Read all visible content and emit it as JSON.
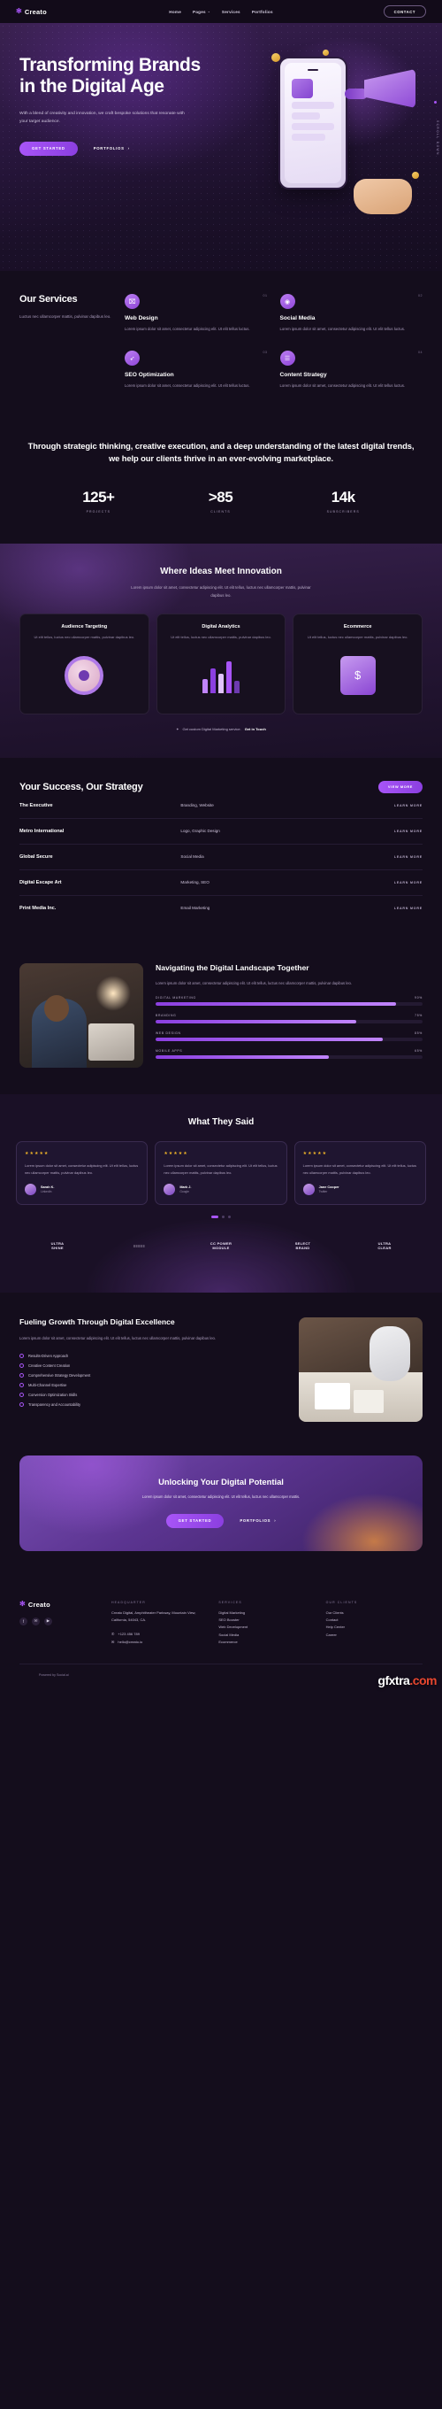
{
  "nav": {
    "brand": "Creato",
    "brand_mark": "leaf-icon",
    "links": [
      {
        "label": "Home",
        "caret": ""
      },
      {
        "label": "Pages",
        "caret": "⌄"
      },
      {
        "label": "Services",
        "caret": ""
      },
      {
        "label": "Portfolios",
        "caret": ""
      }
    ],
    "contact": "CONTACT"
  },
  "hero": {
    "title": "Transforming Brands in the Digital Age",
    "paragraph": "With a blend of creativity and innovation, we craft bespoke solutions that resonate with your target audience.",
    "primary_btn": "GET STARTED",
    "secondary_btn": "PORTFOLIOS",
    "secondary_arrow": "›",
    "side_label": "SCROLL DOWN"
  },
  "services": {
    "title": "Our Services",
    "subtitle": "Luctus nec ullamcorper mattis, pulvinar dapibus leo.",
    "items": [
      {
        "num": "01",
        "icon": "monitor-icon",
        "glyph": "⌧",
        "title": "Web Design",
        "desc": "Lorem ipsum dolor sit amet, consectetur adipiscing elit. Ut elit tellus luctus."
      },
      {
        "num": "02",
        "icon": "megaphone-icon",
        "glyph": "◉",
        "title": "Social Media",
        "desc": "Lorem ipsum dolor sit amet, consectetur adipiscing elit. Ut elit tellus luctus."
      },
      {
        "num": "03",
        "icon": "rocket-icon",
        "glyph": "➶",
        "title": "SEO Optimization",
        "desc": "Lorem ipsum dolor sit amet, consectetur adipiscing elit. Ut elit tellus luctus."
      },
      {
        "num": "04",
        "icon": "chart-icon",
        "glyph": "☰",
        "title": "Content Strategy",
        "desc": "Lorem ipsum dolor sit amet, consectetur adipiscing elit. Ut elit tellus luctus."
      }
    ]
  },
  "statement": {
    "text": "Through strategic thinking, creative execution, and a deep understanding of the latest digital trends, we help our clients thrive in an ever-evolving marketplace.",
    "stats": [
      {
        "value": "125+",
        "label": "PROJECTS"
      },
      {
        "value": ">85",
        "label": "CLIENTS"
      },
      {
        "value": "14k",
        "label": "SUBSCRIBERS"
      }
    ]
  },
  "innovation": {
    "title": "Where Ideas Meet Innovation",
    "subtitle": "Lorem ipsum dolor sit amet, consectetur adipiscing elit. Ut elit tellus, luctus nec ullamcorper mattis, pulvinar dapibus leo.",
    "cards": [
      {
        "title": "Audience Targeting",
        "desc": "Ut elit tellus, luctus nec ullamcorper mattis, pulvinar dapibus leo.",
        "art": "ring-graphic"
      },
      {
        "title": "Digital Analytics",
        "desc": "Ut elit tellus, luctus nec ullamcorper mattis, pulvinar dapibus leo.",
        "art": "bar-chart-graphic"
      },
      {
        "title": "Ecommerce",
        "desc": "Ut elit tellus, luctus nec ullamcorper mattis, pulvinar dapibus leo.",
        "art": "shopping-tag-graphic"
      }
    ],
    "note_icon": "✦",
    "note_text": "Get custom Digital Marketing service.",
    "note_link": "Get in Touch"
  },
  "strategy": {
    "title": "Your Success, Our Strategy",
    "view_more": "VIEW MORE",
    "link_label": "LEARN MORE",
    "rows": [
      {
        "name": "The Executive",
        "tags": "Branding, Website"
      },
      {
        "name": "Metro International",
        "tags": "Logo, Graphic Design"
      },
      {
        "name": "Global Secure",
        "tags": "Social Media"
      },
      {
        "name": "Digital Escape Art",
        "tags": "Marketing, SEO"
      },
      {
        "name": "Print Media Inc.",
        "tags": "Email Marketing"
      }
    ]
  },
  "navigating": {
    "title": "Navigating the Digital Landscape Together",
    "paragraph": "Lorem ipsum dolor sit amet, consectetur adipiscing elit. Ut elit tellus, luctus nec ullamcorper mattis, pulvinar dapibus leo.",
    "bars": [
      {
        "label": "DIGITAL MARKETING",
        "value": "90%",
        "pct": 90
      },
      {
        "label": "BRANDING",
        "value": "75%",
        "pct": 75
      },
      {
        "label": "WEB DESIGN",
        "value": "85%",
        "pct": 85
      },
      {
        "label": "MOBILE APPS",
        "value": "65%",
        "pct": 65
      }
    ]
  },
  "testimonials": {
    "title": "What They Said",
    "stars": "★★★★★",
    "items": [
      {
        "quote": "Lorem ipsum dolor sit amet, consectetur adipiscing elit. Ut elit tellus, luctus nec ullamcorper mattis, pulvinar dapibus leo.",
        "name": "Sarah K.",
        "role": "LinkedIn"
      },
      {
        "quote": "Lorem ipsum dolor sit amet, consectetur adipiscing elit. Ut elit tellus, luctus nec ullamcorper mattis, pulvinar dapibus leo.",
        "name": "Mark J.",
        "role": "Google"
      },
      {
        "quote": "Lorem ipsum dolor sit amet, consectetur adipiscing elit. Ut elit tellus, luctus nec ullamcorper mattis, pulvinar dapibus leo.",
        "name": "Jane Cooper",
        "role": "Twitter"
      }
    ],
    "logos": [
      {
        "line1": "ULTRA",
        "line2": "SHINE"
      },
      {
        "line1": "≡≡≡≡≡",
        "line2": ""
      },
      {
        "line1": "CC POWER",
        "line2": "MODULE"
      },
      {
        "line1": "SELECT",
        "line2": "BRAND"
      },
      {
        "line1": "ULTRA",
        "line2": "CLEAR"
      }
    ]
  },
  "fueling": {
    "title": "Fueling Growth Through Digital Excellence",
    "paragraph": "Lorem ipsum dolor sit amet, consectetur adipiscing elit. Ut elit tellus, luctus nec ullamcorper mattis, pulvinar dapibus leo.",
    "points": [
      "Results-Driven Approach",
      "Creative Content Creation",
      "Comprehensive Strategy Development",
      "Multi-Channel Expertise",
      "Conversion Optimization Skills",
      "Transparency and Accountability"
    ]
  },
  "cta": {
    "title": "Unlocking Your Digital Potential",
    "paragraph": "Lorem ipsum dolor sit amet, consectetur adipiscing elit. Ut elit tellus, luctus nec ullamcorper mattis.",
    "primary_btn": "GET STARTED",
    "secondary_btn": "PORTFOLIOS",
    "secondary_arrow": "›"
  },
  "footer": {
    "brand": "Creato",
    "socials": [
      {
        "name": "facebook-icon",
        "glyph": "f"
      },
      {
        "name": "twitter-icon",
        "glyph": "✉"
      },
      {
        "name": "youtube-icon",
        "glyph": "▶"
      }
    ],
    "headquarter": {
      "heading": "HEADQUARTER",
      "address": "Creato Digital, Amphitheater Parkway, Mountain View, California, 54043, CA.",
      "phone": "+123 456 789",
      "phone_icon": "phone-icon",
      "email": "hello@creato.io",
      "email_icon": "mail-icon"
    },
    "services": {
      "heading": "SERVICES",
      "items": [
        "Digital Marketing",
        "SEO Booster",
        "Web Development",
        "Social Media",
        "Ecommerce"
      ]
    },
    "clients": {
      "heading": "OUR CLIENTS",
      "items": [
        "Our Clients",
        "Contact",
        "Help Center",
        "Career"
      ]
    },
    "powered_by": "Powered by Social.ai",
    "watermark_a": "gfxtra",
    "watermark_b": ".com"
  },
  "colors": {
    "accent": "#a855f7",
    "bg": "#140d1c",
    "card": "#1f1530"
  }
}
